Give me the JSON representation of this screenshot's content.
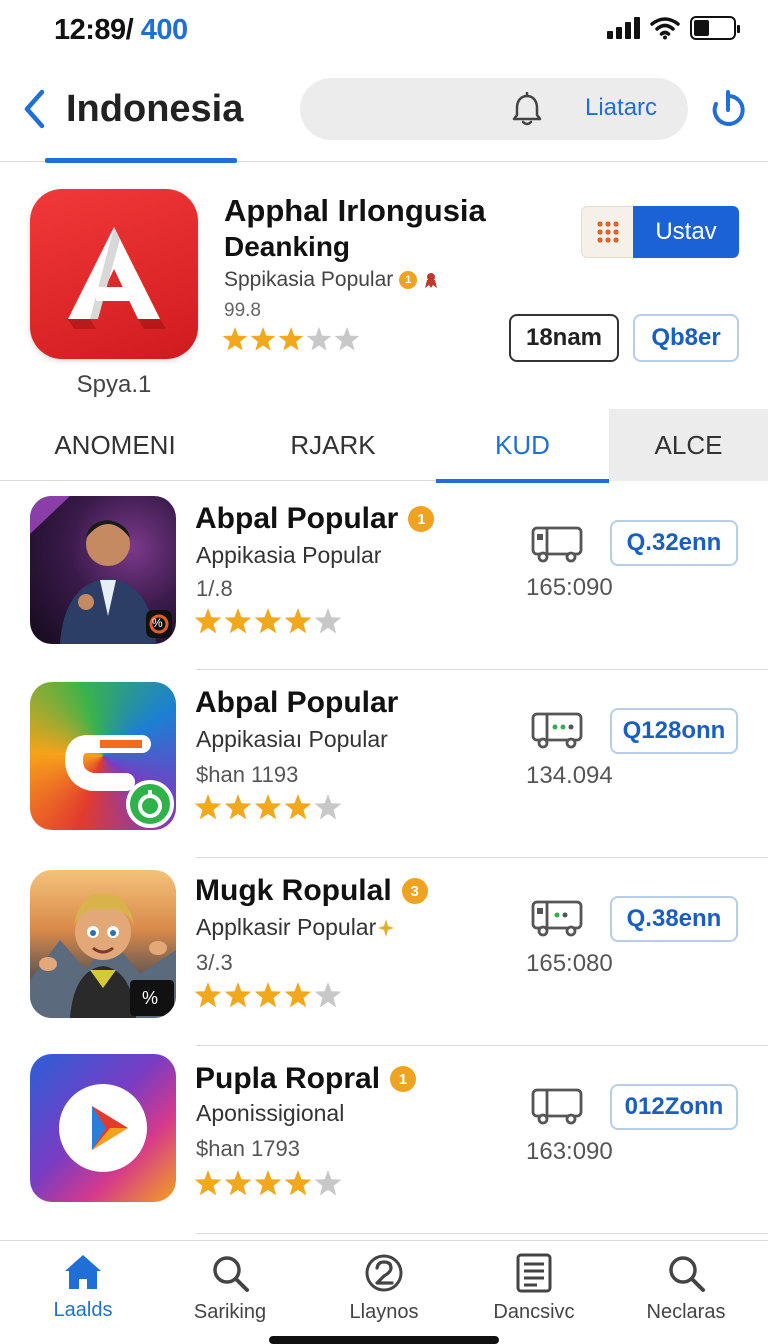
{
  "status": {
    "time_main": "12:89",
    "time_sep": "/",
    "time_accent": "400"
  },
  "header": {
    "title": "Indonesia",
    "search_label": "Liatarc"
  },
  "featured": {
    "title": "Apphal Irlongusia",
    "subtitle": "Deanking",
    "category": "Sppikasia Popular",
    "number": "99.8",
    "caption": "Spya.1",
    "rating": 3,
    "install_label": "Ustav",
    "pill_dark": "18nam",
    "pill_blue": "Qb8er"
  },
  "tabs": [
    {
      "label": "ANOMENI"
    },
    {
      "label": "RJARK"
    },
    {
      "label": "KUD"
    },
    {
      "label": "ALCE"
    }
  ],
  "apps": [
    {
      "name": "Abpal Popular",
      "badge": "1",
      "subtitle": "Appikasia Popular",
      "meta": "1/.8",
      "rating": 4,
      "count": "165:090",
      "button": "Q.32enn",
      "icon_text": "%"
    },
    {
      "name": "Abpal Popular",
      "badge": "",
      "subtitle": "Appikasiaı Popular",
      "meta": "$han 1193",
      "rating": 4,
      "count": "134.094",
      "button": "Q128onn"
    },
    {
      "name": "Mugk Ropulal",
      "badge": "3",
      "subtitle": "Applkasir Popular",
      "meta": "3/.3",
      "rating": 4,
      "count": "165:080",
      "button": "Q.38enn",
      "icon_text": "%"
    },
    {
      "name": "Pupla Ropral",
      "badge": "1",
      "subtitle": "Aponissigional",
      "meta": "$han 1793",
      "rating": 4,
      "count": "163:090",
      "button": "012Zonn"
    }
  ],
  "tabbar": [
    {
      "label": "Laalds",
      "icon": "home-icon"
    },
    {
      "label": "Sariking",
      "icon": "search-icon"
    },
    {
      "label": "Llaynos",
      "icon": "badge-2-icon"
    },
    {
      "label": "Dancsivc",
      "icon": "list-icon"
    },
    {
      "label": "Neclaras",
      "icon": "search-icon"
    }
  ],
  "colors": {
    "accent": "#1f6fd6",
    "star": "#f2a81d",
    "star_empty": "#c8c8c8",
    "install_bg": "#1a62d6",
    "featured_icon": "#e3292b"
  }
}
